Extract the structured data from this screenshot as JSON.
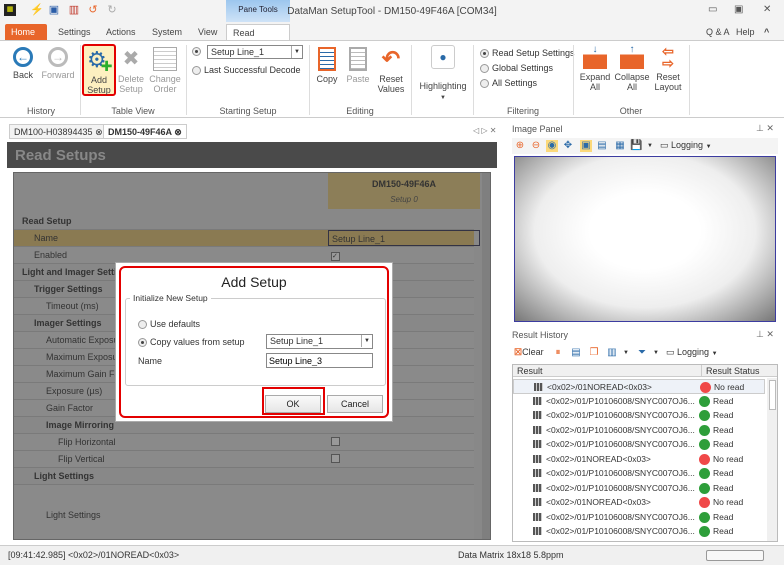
{
  "app": {
    "title": "DataMan SetupTool - DM150-49F46A [COM34]",
    "pane_tools": "Pane Tools"
  },
  "window": {
    "minimize": "▭",
    "maximize": "▣",
    "close": "✕",
    "qa": "Q & A",
    "help": "Help",
    "collapse": "^"
  },
  "tabs": [
    "Home",
    "Settings",
    "Actions",
    "System",
    "View",
    "Read Setups"
  ],
  "ribbon": {
    "history": {
      "label": "History",
      "back": "Back",
      "forward": "Forward"
    },
    "table_view": {
      "label": "Table View",
      "add": "Add Setup",
      "delete": "Delete Setup",
      "change": "Change Order"
    },
    "starting": {
      "label": "Starting Setup",
      "selected": "Setup Line_1",
      "last": "Last Successful Decode"
    },
    "editing": {
      "label": "Editing",
      "copy": "Copy",
      "paste": "Paste",
      "reset": "Reset Values"
    },
    "highlighting": "Highlighting",
    "filtering": {
      "label": "Filtering",
      "options": [
        "Read Setup Settings",
        "Global Settings",
        "All Settings"
      ]
    },
    "other": {
      "label": "Other",
      "expand": "Expand All",
      "collapse": "Collapse All",
      "reset_layout": "Reset Layout"
    }
  },
  "doc_tabs": [
    "DM100-H03894435",
    "DM150-49F46A"
  ],
  "read_setups": {
    "title": "Read Setups",
    "device": "DM150-49F46A",
    "setup": "Setup 0",
    "rows": [
      {
        "label": "Read Setup",
        "level": 0,
        "group": true
      },
      {
        "label": "Name",
        "level": 1,
        "value": "Setup Line_1"
      },
      {
        "label": "Enabled",
        "level": 1,
        "check": true
      },
      {
        "label": "Light and Imager Settings",
        "level": 0,
        "group": true
      },
      {
        "label": "Trigger Settings",
        "level": 1,
        "group": true
      },
      {
        "label": "Timeout (ms)",
        "level": 2
      },
      {
        "label": "Imager Settings",
        "level": 1,
        "group": true
      },
      {
        "label": "Automatic Exposure",
        "level": 2
      },
      {
        "label": "Maximum Exposure",
        "level": 2
      },
      {
        "label": "Maximum Gain Factor",
        "level": 2
      },
      {
        "label": "Exposure (µs)",
        "level": 2
      },
      {
        "label": "Gain Factor",
        "level": 2
      },
      {
        "label": "Image Mirroring",
        "level": 2,
        "group": true
      },
      {
        "label": "Flip Horizontal",
        "level": 3,
        "check": false
      },
      {
        "label": "Flip Vertical",
        "level": 3,
        "check": false
      },
      {
        "label": "Light Settings",
        "level": 1,
        "group": true
      },
      {
        "label": "Light Settings",
        "level": 2,
        "tall": true
      }
    ]
  },
  "dialog": {
    "title": "Add Setup",
    "legend": "Initialize New Setup",
    "use_defaults": "Use defaults",
    "copy_values": "Copy values from setup",
    "copy_from": "Setup Line_1",
    "name_label": "Name",
    "name_value": "Setup Line_3",
    "ok": "OK",
    "cancel": "Cancel"
  },
  "image_panel": {
    "title": "Image Panel",
    "logging": "Logging"
  },
  "result_history": {
    "title": "Result History",
    "clear": "Clear",
    "logging": "Logging",
    "col_result": "Result",
    "col_status": "Result Status",
    "rows": [
      {
        "result": "<0x02>/01NOREAD<0x03>",
        "status": "No read"
      },
      {
        "result": "<0x02>/01/P10106008/SNYC007OJ6...",
        "status": "Read"
      },
      {
        "result": "<0x02>/01/P10106008/SNYC007OJ6...",
        "status": "Read"
      },
      {
        "result": "<0x02>/01/P10106008/SNYC007OJ6...",
        "status": "Read"
      },
      {
        "result": "<0x02>/01/P10106008/SNYC007OJ6...",
        "status": "Read"
      },
      {
        "result": "<0x02>/01NOREAD<0x03>",
        "status": "No read"
      },
      {
        "result": "<0x02>/01/P10106008/SNYC007OJ6...",
        "status": "Read"
      },
      {
        "result": "<0x02>/01/P10106008/SNYC007OJ6...",
        "status": "Read"
      },
      {
        "result": "<0x02>/01NOREAD<0x03>",
        "status": "No read"
      },
      {
        "result": "<0x02>/01/P10106008/SNYC007OJ6...",
        "status": "Read"
      },
      {
        "result": "<0x02>/01/P10106008/SNYC007OJ6...",
        "status": "Read"
      }
    ]
  },
  "status": {
    "left": "[09:41:42.985] <0x02>/01NOREAD<0x03>",
    "center": "Data Matrix 18x18 5.8ppm"
  },
  "colors": {
    "read": "#2e9e3a",
    "noread": "#f04848",
    "accent": "#e8652a",
    "highlight": "#e30000"
  }
}
